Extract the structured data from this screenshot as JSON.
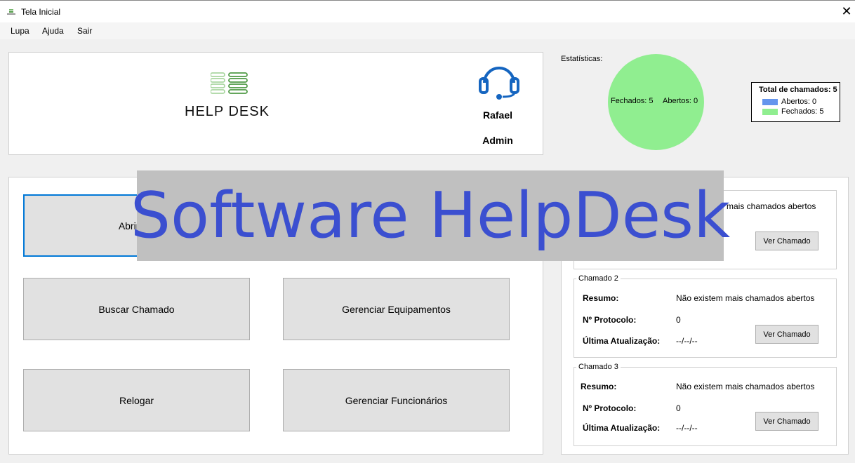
{
  "window": {
    "title": "Tela Inicial",
    "close": "✕"
  },
  "menu": [
    "Lupa",
    "Ajuda",
    "Sair"
  ],
  "header": {
    "logo_text": "HELP DESK",
    "user_name": "Rafael",
    "user_role": "Admin"
  },
  "stats": {
    "label": "Estatísticas:",
    "closed_label": "Fechados: 5",
    "open_label": "Abertos: 0",
    "legend_title": "Total de chamados: 5",
    "legend": [
      {
        "label": "Abertos: 0",
        "color": "#6495ed"
      },
      {
        "label": "Fechados: 5",
        "color": "#90ee90"
      }
    ]
  },
  "chart_data": {
    "type": "pie",
    "categories": [
      "Abertos",
      "Fechados"
    ],
    "values": [
      0,
      5
    ],
    "colors": [
      "#6495ed",
      "#90ee90"
    ],
    "legend_title": "Total de chamados: 5"
  },
  "actions": {
    "open_ticket": "Abrir Ch",
    "search_ticket": "Buscar Chamado",
    "manage_equipment": "Gerenciar Equipamentos",
    "relog": "Relogar",
    "manage_staff": "Gerenciar Funcionários"
  },
  "tickets": {
    "first_summary_visible": "mais chamados abertos",
    "view_button": "Ver Chamado",
    "items": [
      {
        "title": "Chamado 2",
        "resumo_label": "Resumo:",
        "resumo": "Não existem mais chamados abertos",
        "protocolo_label": "Nº Protocolo:",
        "protocolo": "0",
        "atualizacao_label": "Última Atualização:",
        "atualizacao": "--/--/--"
      },
      {
        "title": "Chamado 3",
        "resumo_label": "Resumo:",
        "resumo": "Não existem mais chamados abertos",
        "protocolo_label": "Nº Protocolo:",
        "protocolo": "0",
        "atualizacao_label": "Última Atualização:",
        "atualizacao": "--/--/--"
      }
    ]
  },
  "overlay": {
    "text": "Software HelpDesk"
  }
}
